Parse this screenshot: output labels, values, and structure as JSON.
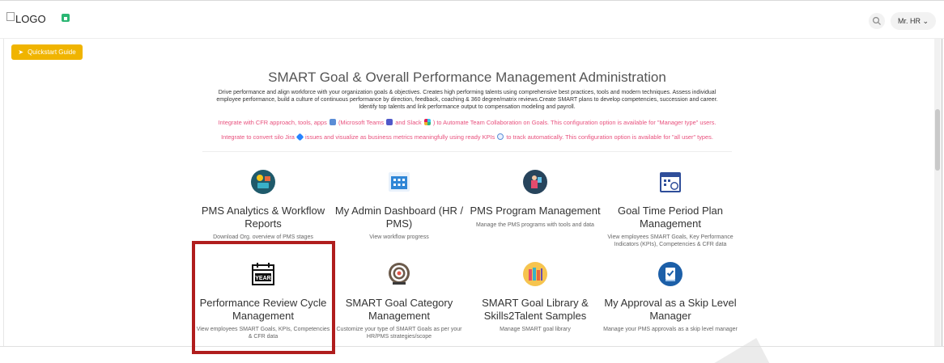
{
  "header": {
    "logo_alt": "LOGO",
    "user_label": "Mr. HR"
  },
  "quickstart_label": "Quickstart Guide",
  "main": {
    "title": "SMART Goal & Overall Performance Management Administration",
    "description_lines": [
      "Drive performance and align workforce with your organization goals & objectives. Creates high performing talents using comprehensive best practices, tools and modern techniques. Assess individual",
      "employee performance, build a culture of continuous performance by direction, feedback, coaching & 360 degree/matrix reviews.Create SMART plans to develop competencies, succession and career.",
      "Identify top talents and link performance output to compensation modeling and payroll."
    ],
    "integration_line1": {
      "a": "Integrate with CFR approach, tools, apps",
      "b": "(Microsoft Teams",
      "c": "and Slack",
      "d": ") to Automate Team Collaboration on Goals. This configuration option is available for \"Manager type\" users."
    },
    "integration_line2": {
      "a": "Integrate to convert silo Jira",
      "b": "issues and visualize as business metrics meaningfully using ready KPIs",
      "c": "to track automatically. This configuration option is available for \"all user\" types."
    }
  },
  "cards": [
    {
      "title": "PMS Analytics & Workflow Reports",
      "subtitle": "Download Org. overview of PMS stages",
      "icon": "analytics-icon"
    },
    {
      "title": "My Admin Dashboard (HR / PMS)",
      "subtitle": "View workflow progress",
      "icon": "dashboard-icon"
    },
    {
      "title": "PMS Program Management",
      "subtitle": "Manage the PMS programs with tools and data",
      "icon": "program-icon"
    },
    {
      "title": "Goal Time Period Plan Management",
      "subtitle": "View employees SMART Goals, Key Performance Indicators (KPIs), Competencies & CFR data",
      "icon": "calendar-clock-icon"
    },
    {
      "title": "Performance Review Cycle Management",
      "subtitle": "View employees SMART Goals, KPIs, Competencies & CFR data",
      "icon": "year-calendar-icon",
      "icon_text": "YEAR"
    },
    {
      "title": "SMART Goal Category Management",
      "subtitle": "Customize your type of SMART Goals as per your HR/PMS strategies/scope",
      "icon": "target-icon"
    },
    {
      "title": "SMART Goal Library & Skills2Talent Samples",
      "subtitle": "Manage SMART goal library",
      "icon": "library-icon"
    },
    {
      "title": "My Approval as a Skip Level Manager",
      "subtitle": "Manage your PMS approvals as a skip level manager",
      "icon": "approval-icon"
    }
  ],
  "colors": {
    "accent": "#f0b400",
    "pink": "#e8507d",
    "highlight": "#b01d1d"
  }
}
